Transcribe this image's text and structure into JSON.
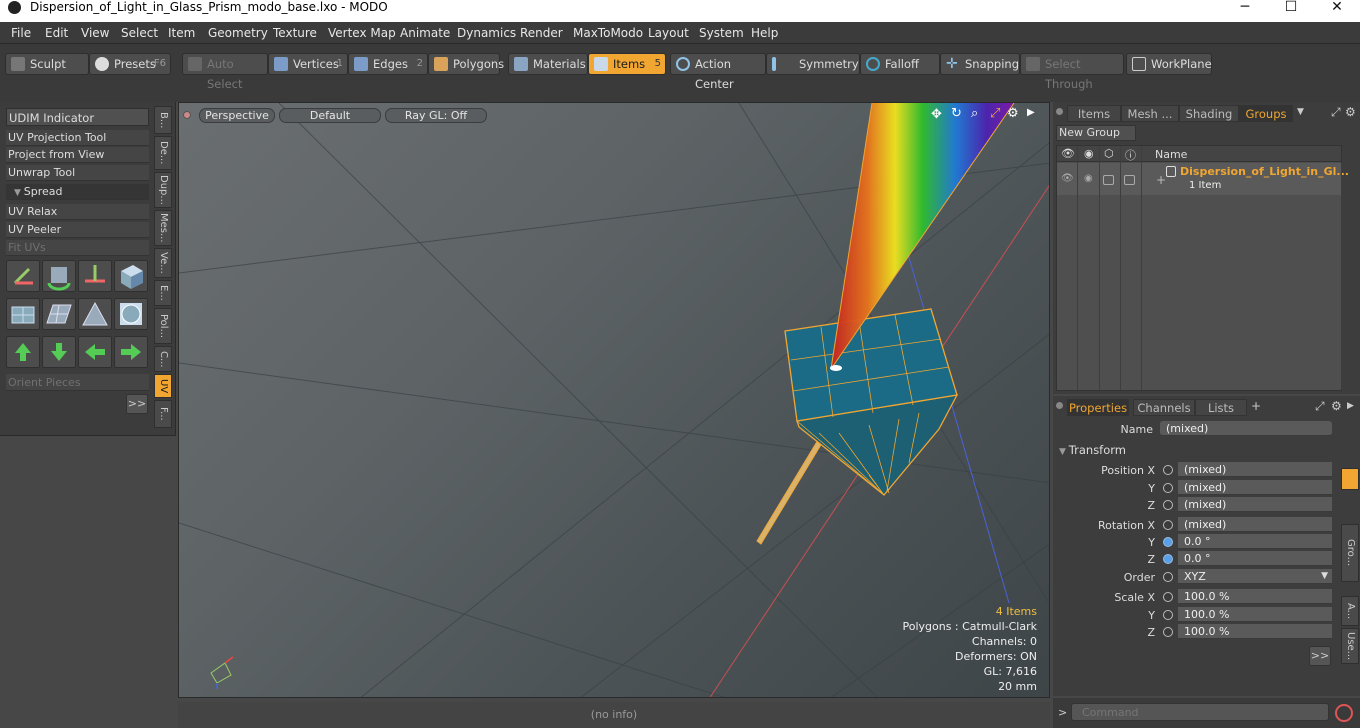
{
  "window": {
    "title": "Dispersion_of_Light_in_Glass_Prism_modo_base.lxo - MODO",
    "minimize": "─",
    "maximize": "☐",
    "close": "✕"
  },
  "menu": [
    "File",
    "Edit",
    "View",
    "Select",
    "Item",
    "Geometry",
    "Texture",
    "Vertex Map",
    "Animate",
    "Dynamics",
    "Render",
    "MaxToModo",
    "Layout",
    "System",
    "Help"
  ],
  "toolbar": {
    "sculpt": "Sculpt",
    "presets": "Presets",
    "presets_key": "F6",
    "auto_select": "Auto Select",
    "vertices": "Vertices",
    "vertices_key": "1",
    "edges": "Edges",
    "edges_key": "2",
    "polygons": "Polygons",
    "materials": "Materials",
    "items": "Items",
    "items_key": "5",
    "action_center": "Action Center",
    "symmetry": "Symmetry",
    "falloff": "Falloff",
    "snapping": "Snapping",
    "select_through": "Select Through",
    "workplane": "WorkPlane"
  },
  "left_panel": {
    "udim": "UDIM Indicator",
    "uv_projection": "UV Projection Tool",
    "project_view": "Project from View",
    "unwrap": "Unwrap Tool",
    "spread": "Spread",
    "uv_relax": "UV Relax",
    "uv_peeler": "UV Peeler",
    "fit_uvs": "Fit UVs",
    "orient": "Orient Pieces",
    "more": ">>",
    "vtabs": [
      "B...",
      "De...",
      "Dup...",
      "Mes...",
      "Ve...",
      "E...",
      "Pol...",
      "C...",
      "UV",
      "F..."
    ]
  },
  "viewport": {
    "view": "Perspective",
    "shading": "Default",
    "raygl": "Ray GL: Off",
    "items": "4 Items",
    "polygons": "Polygons : Catmull-Clark",
    "channels": "Channels: 0",
    "deformers": "Deformers: ON",
    "gl": "GL: 7,616",
    "scale": "20 mm"
  },
  "status": "(no info)",
  "groups_panel": {
    "tabs": [
      "Items",
      "Mesh ...",
      "Shading",
      "Groups"
    ],
    "new_group": "New Group",
    "col_name": "Name",
    "group_name": "Dispersion_of_Light_in_Gl...",
    "group_count": "1 Item"
  },
  "properties_panel": {
    "tabs": [
      "Properties",
      "Channels",
      "Lists"
    ],
    "add": "+",
    "name_label": "Name",
    "name_value": "(mixed)",
    "transform": "Transform",
    "position_x_label": "Position X",
    "y_label": "Y",
    "z_label": "Z",
    "pos_x": "(mixed)",
    "pos_y": "(mixed)",
    "pos_z": "(mixed)",
    "rotation_x_label": "Rotation X",
    "rot_x": "(mixed)",
    "rot_y": "0.0 °",
    "rot_z": "0.0 °",
    "order_label": "Order",
    "order_value": "XYZ",
    "scale_x_label": "Scale X",
    "scale_x": "100.0 %",
    "scale_y": "100.0 %",
    "scale_z": "100.0 %",
    "more": ">>",
    "side_tabs": [
      "Gro...",
      "A...",
      "Use..."
    ]
  },
  "command": {
    "placeholder": "Command",
    "prompt": ">"
  },
  "colors": {
    "accent": "#f0a631",
    "panel": "#3d3d3d",
    "selected_item": "#f0a631"
  }
}
